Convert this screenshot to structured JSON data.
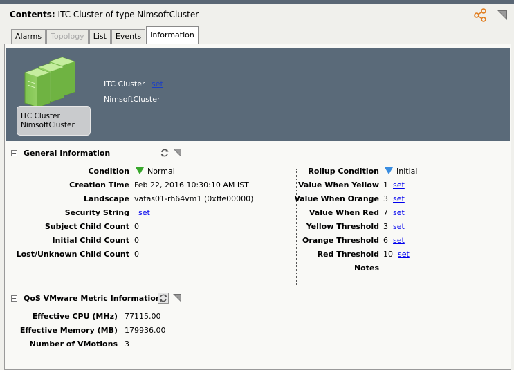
{
  "header": {
    "contents_label": "Contents:",
    "title": "ITC Cluster of type NimsoftCluster",
    "share_icon": "share-icon",
    "menu_icon": "corner-menu-icon"
  },
  "tabs": [
    {
      "label": "Alarms",
      "state": "normal"
    },
    {
      "label": "Topology",
      "state": "disabled"
    },
    {
      "label": "List",
      "state": "normal"
    },
    {
      "label": "Events",
      "state": "normal"
    },
    {
      "label": "Information",
      "state": "active"
    }
  ],
  "banner": {
    "device_label_line1": "ITC Cluster",
    "device_label_line2": "NimsoftCluster",
    "name": "ITC Cluster",
    "name_set": "set",
    "type": "NimsoftCluster"
  },
  "general": {
    "title": "General Information",
    "left": [
      {
        "label": "Condition",
        "value": "Normal",
        "icon": "green-down-triangle"
      },
      {
        "label": "Creation Time",
        "value": "Feb 22, 2016 10:30:10 AM IST"
      },
      {
        "label": "Landscape",
        "value": "vatas01-rh64vm1 (0xffe00000)"
      },
      {
        "label": "Security String",
        "value": "",
        "link": "set"
      },
      {
        "label": "Subject Child Count",
        "value": "0"
      },
      {
        "label": "Initial Child Count",
        "value": "0"
      },
      {
        "label": "Lost/Unknown Child Count",
        "value": "0"
      }
    ],
    "right": [
      {
        "label": "Rollup Condition",
        "value": "Initial",
        "icon": "blue-down-triangle"
      },
      {
        "label": "Value When Yellow",
        "value": "1",
        "link": "set"
      },
      {
        "label": "Value When Orange",
        "value": "3",
        "link": "set"
      },
      {
        "label": "Value When Red",
        "value": "7",
        "link": "set"
      },
      {
        "label": "Yellow Threshold",
        "value": "3",
        "link": "set"
      },
      {
        "label": "Orange Threshold",
        "value": "6",
        "link": "set"
      },
      {
        "label": "Red Threshold",
        "value": "10",
        "link": "set"
      },
      {
        "label": "Notes",
        "value": ""
      }
    ]
  },
  "qos": {
    "title": "QoS VMware Metric Information",
    "rows": [
      {
        "label": "Effective CPU (MHz)",
        "value": "77115.00"
      },
      {
        "label": "Effective Memory (MB)",
        "value": "179936.00"
      },
      {
        "label": "Number of VMotions",
        "value": "3"
      }
    ]
  },
  "colors": {
    "banner": "#5a6a79",
    "normal": "#38a82c",
    "initial": "#3a8de0"
  }
}
